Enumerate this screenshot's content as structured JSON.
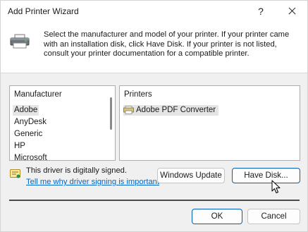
{
  "window": {
    "title": "Add Printer Wizard",
    "help_label": "?"
  },
  "header": {
    "instructions": "Select the manufacturer and model of your printer. If your printer came with an installation disk, click Have Disk. If your printer is not listed, consult your printer documentation for a compatible printer."
  },
  "manufacturers": {
    "header": "Manufacturer",
    "items": [
      "Adobe",
      "AnyDesk",
      "Generic",
      "HP",
      "Microsoft"
    ],
    "selected": "Adobe"
  },
  "printers": {
    "header": "Printers",
    "items": [
      "Adobe PDF Converter"
    ],
    "selected": "Adobe PDF Converter"
  },
  "signing": {
    "status_text": "This driver is digitally signed.",
    "link_text": "Tell me why driver signing is important"
  },
  "buttons": {
    "windows_update": "Windows Update",
    "have_disk": "Have Disk...",
    "ok": "OK",
    "cancel": "Cancel"
  },
  "colors": {
    "link": "#0066cc",
    "primary_border": "#005fb8",
    "selection": "#e5e5e5"
  }
}
